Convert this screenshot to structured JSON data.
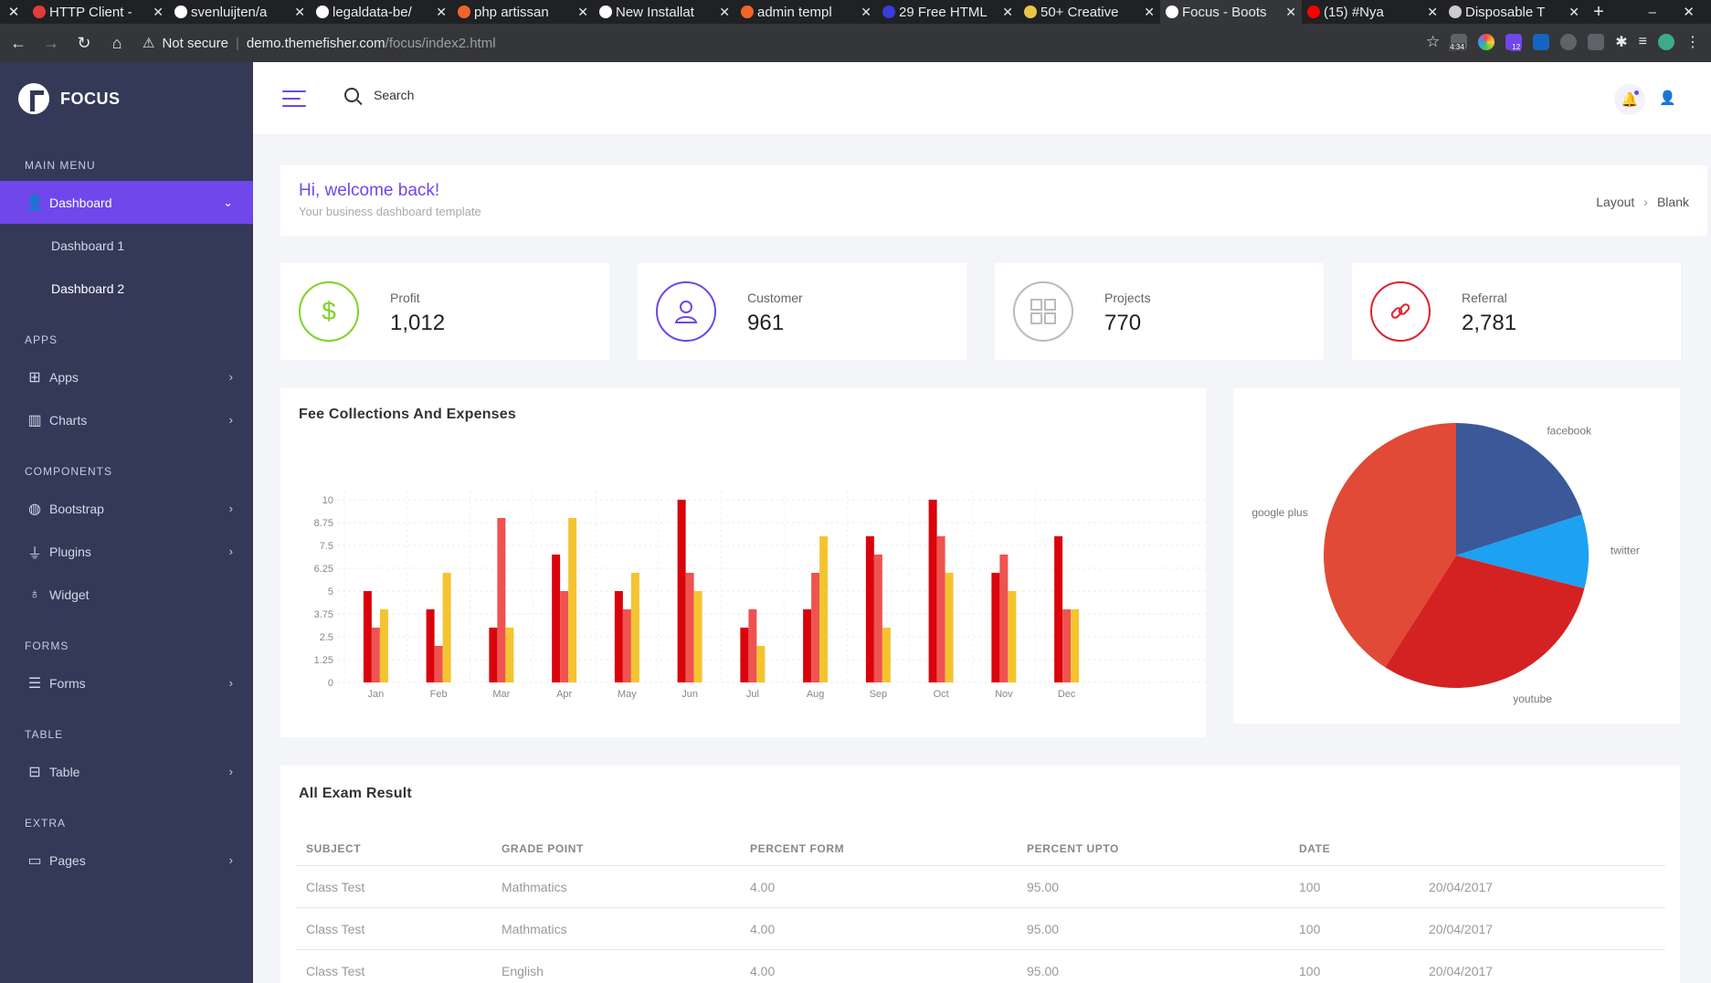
{
  "browser": {
    "tabs": [
      {
        "label": "HTTP Client -",
        "color": "#e23b3b"
      },
      {
        "label": "svenluijten/a",
        "color": "#ffffff"
      },
      {
        "label": "legaldata-be/",
        "color": "#ffffff"
      },
      {
        "label": "php artissan",
        "color": "#f06529"
      },
      {
        "label": "New Installat",
        "color": "#ffffff"
      },
      {
        "label": "admin templ",
        "color": "#f06529"
      },
      {
        "label": "29 Free HTML",
        "color": "#3b3bd9"
      },
      {
        "label": "50+ Creative",
        "color": "#e8c547"
      },
      {
        "label": "Focus - Boots",
        "color": "#ffffff"
      },
      {
        "label": "(15) #Nya",
        "color": "#ff0000"
      },
      {
        "label": "Disposable T",
        "color": "#cccccc"
      }
    ],
    "not_secure": "Not secure",
    "url_host": "demo.themefisher.com",
    "url_path": "/focus/index2.html",
    "ext_badges": [
      "4:34",
      "12"
    ]
  },
  "sidebar": {
    "brand": "FOCUS",
    "sections": {
      "main": "MAIN MENU",
      "apps": "APPS",
      "components": "COMPONENTS",
      "forms": "FORMS",
      "table": "TABLE",
      "extra": "EXTRA"
    },
    "dashboard": "Dashboard",
    "dashboard1": "Dashboard 1",
    "dashboard2": "Dashboard 2",
    "apps": "Apps",
    "charts": "Charts",
    "bootstrap": "Bootstrap",
    "plugins": "Plugins",
    "widget": "Widget",
    "forms": "Forms",
    "table": "Table",
    "pages": "Pages"
  },
  "topbar": {
    "search_label": "Search"
  },
  "welcome": {
    "title": "Hi, welcome back!",
    "subtitle": "Your business dashboard template",
    "breadcrumb": [
      "Layout",
      "Blank"
    ]
  },
  "stats": [
    {
      "label": "Profit",
      "value": "1,012",
      "icon": "dollar-icon",
      "color": "#7ed321"
    },
    {
      "label": "Customer",
      "value": "961",
      "icon": "user-icon",
      "color": "#6f47eb"
    },
    {
      "label": "Projects",
      "value": "770",
      "icon": "grid-icon",
      "color": "#bbbbbb"
    },
    {
      "label": "Referral",
      "value": "2,781",
      "icon": "link-icon",
      "color": "#e3202e"
    }
  ],
  "fee_chart": {
    "title": "Fee Collections And Expenses"
  },
  "chart_data": [
    {
      "type": "bar",
      "categories": [
        "Jan",
        "Feb",
        "Mar",
        "Apr",
        "May",
        "Jun",
        "Jul",
        "Aug",
        "Sep",
        "Oct",
        "Nov",
        "Dec"
      ],
      "series": [
        {
          "values": [
            5,
            4,
            3,
            7,
            5,
            10,
            3,
            4,
            8,
            10,
            6,
            8
          ],
          "color": "#d9040b"
        },
        {
          "values": [
            3,
            2,
            9,
            5,
            4,
            6,
            4,
            6,
            7,
            8,
            7,
            4
          ],
          "color": "#ef5350"
        },
        {
          "values": [
            4,
            6,
            3,
            9,
            6,
            5,
            2,
            8,
            3,
            6,
            5,
            4
          ],
          "color": "#f4c430"
        }
      ],
      "yticks": [
        "0",
        "1.25",
        "2.5",
        "3.75",
        "5",
        "6.25",
        "7.5",
        "8.75",
        "10"
      ],
      "ylim": [
        0,
        10
      ],
      "grid": true
    },
    {
      "type": "pie",
      "labels": [
        "facebook",
        "twitter",
        "youtube",
        "google plus"
      ],
      "values": [
        20,
        9,
        30,
        41
      ],
      "colors": [
        "#3b5998",
        "#1da1f2",
        "#d42222",
        "#e04a37"
      ]
    }
  ],
  "exam": {
    "title": "All Exam Result",
    "headers": [
      "SUBJECT",
      "GRADE POINT",
      "PERCENT FORM",
      "PERCENT UPTO",
      "DATE",
      ""
    ],
    "rows": [
      [
        "Class Test",
        "Mathmatics",
        "4.00",
        "95.00",
        "100",
        "20/04/2017"
      ],
      [
        "Class Test",
        "Mathmatics",
        "4.00",
        "95.00",
        "100",
        "20/04/2017"
      ],
      [
        "Class Test",
        "English",
        "4.00",
        "95.00",
        "100",
        "20/04/2017"
      ]
    ]
  }
}
